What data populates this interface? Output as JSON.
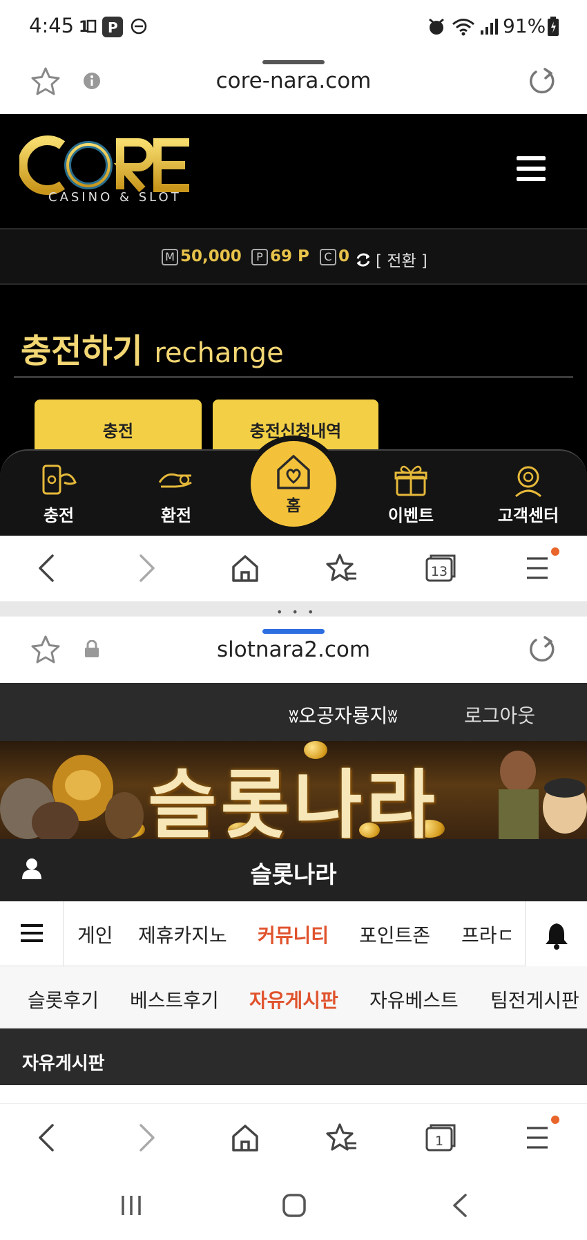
{
  "status_bar": {
    "time": "4:45",
    "battery": "91%",
    "icons": [
      "sim-icon",
      "parking-icon",
      "dnd-icon",
      "alarm-icon",
      "wifi-icon",
      "signal-icon",
      "battery-icon"
    ]
  },
  "top_browser": {
    "url": "core-nara.com",
    "tabs_count": "13"
  },
  "core_site": {
    "logo_text": "CORE",
    "logo_subtitle": "CASINO & SLOT",
    "balance": {
      "money_label": "M",
      "money": "50,000",
      "point_label": "P",
      "points": "69 P",
      "comp_label": "C",
      "comp": "0",
      "switch_label": "[ 전환 ]"
    },
    "page_title_ko": "충전하기",
    "page_title_en": "rechange",
    "tabs": [
      "충전",
      "충전신청내역"
    ],
    "bottom_nav": {
      "charge": "충전",
      "exchange": "환전",
      "home": "홈",
      "event": "이벤트",
      "support": "고객센터"
    }
  },
  "bottom_browser": {
    "url": "slotnara2.com",
    "tabs_count": "1"
  },
  "slot_site": {
    "username": "ʬ오공자룡지ʬ",
    "logout": "로그아웃",
    "banner_text": "슬롯나라",
    "brand_title": "슬롯나라",
    "menu": [
      "게인",
      "제휴카지노",
      "커뮤니티",
      "포인트존",
      "프라ㄷ"
    ],
    "menu_active": "커뮤니티",
    "submenu": [
      "슬롯후기",
      "베스트후기",
      "자유게시판",
      "자유베스트",
      "팀전게시판"
    ],
    "submenu_active": "자유게시판",
    "board_title": "자유게시판"
  },
  "colors": {
    "gold": "#f2cf45",
    "accent_orange": "#e0532d",
    "dark_bg": "#000000"
  }
}
